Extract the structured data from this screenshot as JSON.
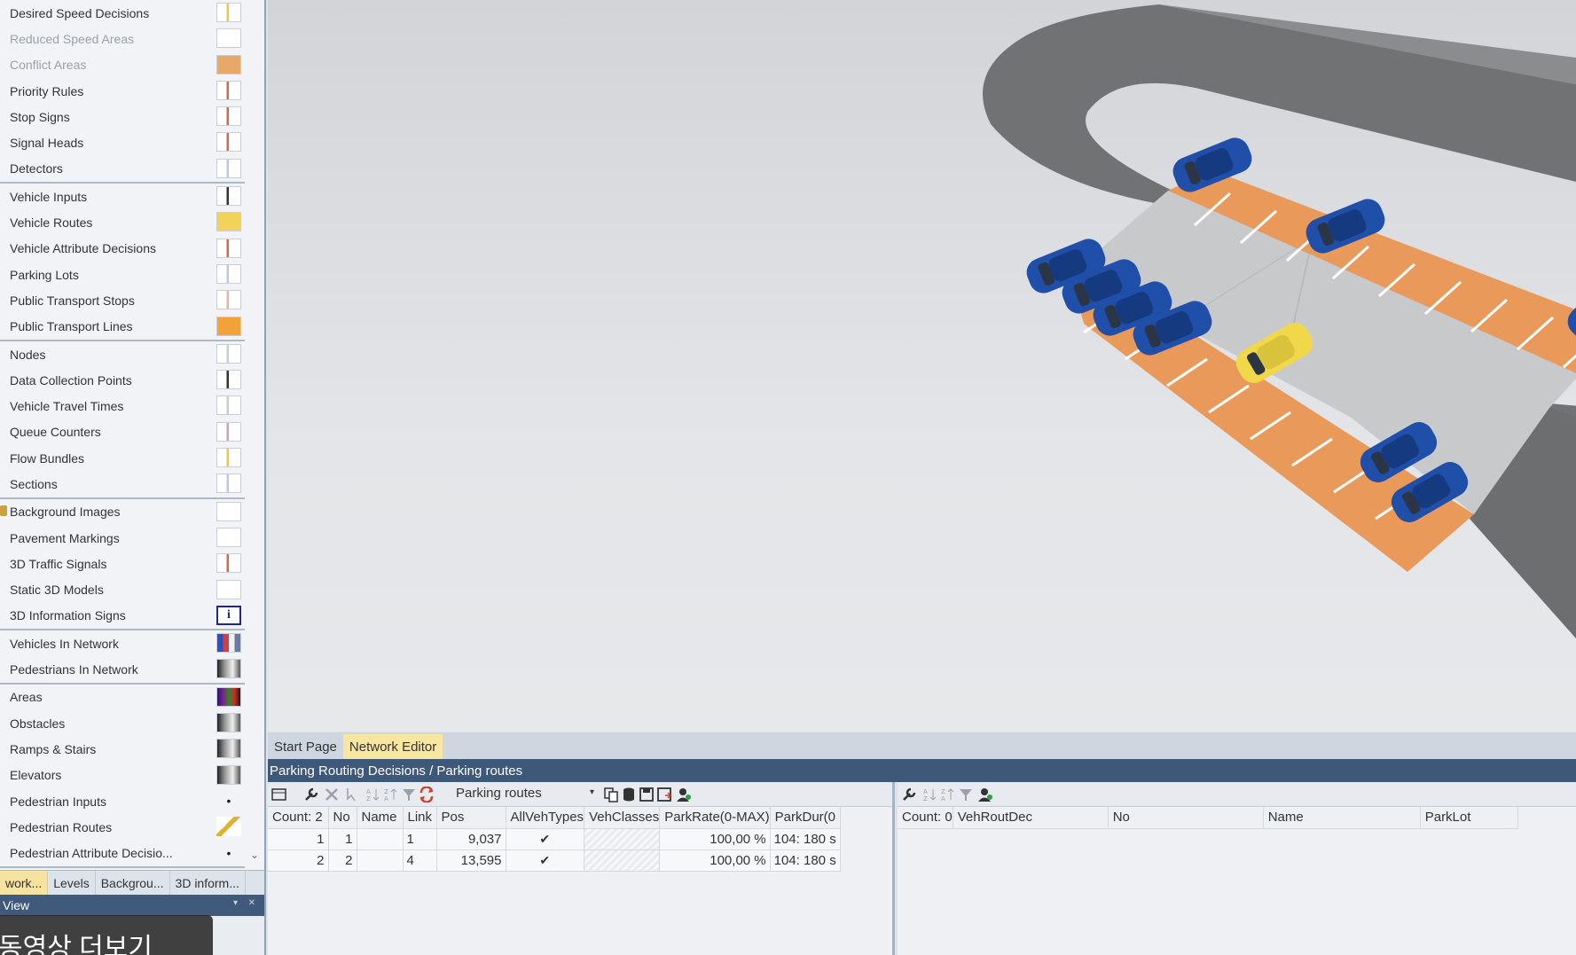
{
  "object_list": {
    "groups": [
      [
        {
          "label": "Desired Speed Decisions",
          "muted": false,
          "swatch": "#f3c53a"
        },
        {
          "label": "Reduced Speed Areas",
          "muted": true,
          "swatch": ""
        },
        {
          "label": "Conflict Areas",
          "muted": true,
          "swatch": "#e7a86a"
        },
        {
          "label": "Priority Rules",
          "muted": false,
          "swatch": "#e5624a"
        },
        {
          "label": "Stop Signs",
          "muted": false,
          "swatch": "#e5624a"
        },
        {
          "label": "Signal Heads",
          "muted": false,
          "swatch": "#e5624a"
        },
        {
          "label": "Detectors",
          "muted": false,
          "swatch": "#b9c6f0"
        }
      ],
      [
        {
          "label": "Vehicle Inputs",
          "muted": false,
          "swatch": "#333333"
        },
        {
          "label": "Vehicle Routes",
          "muted": false,
          "swatch": "#f2d35a"
        },
        {
          "label": "Vehicle Attribute Decisions",
          "muted": false,
          "swatch": "#e5624a"
        },
        {
          "label": "Parking Lots",
          "muted": false,
          "swatch": "#b9c6f0"
        },
        {
          "label": "Public Transport Stops",
          "muted": false,
          "swatch": "#f0b0a0"
        },
        {
          "label": "Public Transport Lines",
          "muted": false,
          "swatch": "#f3a23a"
        }
      ],
      [
        {
          "label": "Nodes",
          "muted": false,
          "swatch": "#c8ced6"
        },
        {
          "label": "Data Collection Points",
          "muted": false,
          "swatch": "#333333"
        },
        {
          "label": "Vehicle Travel Times",
          "muted": false,
          "swatch": "#c8ced6"
        },
        {
          "label": "Queue Counters",
          "muted": false,
          "swatch": "#c9a0c9"
        },
        {
          "label": "Flow Bundles",
          "muted": false,
          "swatch": "#f3c53a"
        },
        {
          "label": "Sections",
          "muted": false,
          "swatch": "#b9c6f0"
        }
      ],
      [
        {
          "label": "Background Images",
          "muted": false,
          "swatch": "",
          "lock": true
        },
        {
          "label": "Pavement Markings",
          "muted": false,
          "swatch": ""
        },
        {
          "label": "3D Traffic Signals",
          "muted": false,
          "swatch": "#e5624a"
        },
        {
          "label": "Static 3D Models",
          "muted": false,
          "swatch": ""
        },
        {
          "label": "3D Information Signs",
          "muted": false,
          "swatch": "info"
        }
      ],
      [
        {
          "label": "Vehicles In Network",
          "muted": false,
          "swatch": "multi"
        },
        {
          "label": "Pedestrians In Network",
          "muted": false,
          "swatch": "gray"
        }
      ],
      [
        {
          "label": "Areas",
          "muted": false,
          "swatch": "rainbow"
        },
        {
          "label": "Obstacles",
          "muted": false,
          "swatch": "gray"
        },
        {
          "label": "Ramps & Stairs",
          "muted": false,
          "swatch": "gray"
        },
        {
          "label": "Elevators",
          "muted": false,
          "swatch": "gray"
        },
        {
          "label": "Pedestrian Inputs",
          "muted": false,
          "swatch": "dot"
        },
        {
          "label": "Pedestrian Routes",
          "muted": false,
          "swatch": "diag"
        },
        {
          "label": "Pedestrian Attribute Decisio...",
          "muted": false,
          "swatch": "dot"
        }
      ]
    ],
    "info_glyph": "i",
    "dot_glyph": "•",
    "scroll_glyph": "⌄"
  },
  "left_tabs": [
    "work...",
    "Levels",
    "Backgrou...",
    "3D inform..."
  ],
  "view_panel": {
    "title": "View",
    "pin": "▾",
    "close": "✕"
  },
  "overlay_text": "동영상 더보기",
  "doc_tabs": [
    {
      "label": "Start Page",
      "active": false
    },
    {
      "label": "Network Editor",
      "active": true
    }
  ],
  "list_title": "Parking Routing Decisions / Parking routes",
  "left_list": {
    "select_value": "Parking routes",
    "columns": [
      "Count: 2",
      "No",
      "Name",
      "Link",
      "Pos",
      "AllVehTypes",
      "VehClasses",
      "ParkRate(0-MAX)",
      "ParkDur(0"
    ],
    "rows": [
      [
        "1",
        "1",
        "",
        "1",
        "9,037",
        "✔",
        "",
        "100,00 %",
        "104: 180 s"
      ],
      [
        "2",
        "2",
        "",
        "4",
        "13,595",
        "✔",
        "",
        "100,00 %",
        "104: 180 s"
      ]
    ]
  },
  "right_list": {
    "columns": [
      "Count: 0",
      "VehRoutDec",
      "No",
      "Name",
      "ParkLot"
    ]
  },
  "colors": {
    "asphalt": "#6f7173",
    "parking_orange": "#e99a5a",
    "plaza": "#c8c9cb",
    "car_blue": "#1f4fa8",
    "car_yellow": "#f0d84a",
    "title_bar": "#3d5878",
    "tab_active": "#f9e7a1"
  }
}
